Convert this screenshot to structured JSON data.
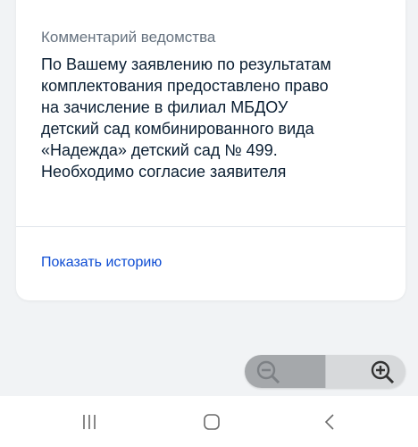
{
  "card": {
    "comment_label": "Комментарий ведомства",
    "comment_text": "По Вашему заявлению по результатам\nкомплектования предоставлено право\nна зачисление в филиал МБДОУ\nдетский сад комбинированного вида\n«Надежда» детский сад № 499.\nНеобходимо согласие заявителя",
    "show_history_link": "Показать историю"
  },
  "zoom": {
    "out_icon": "zoom-out-icon",
    "in_icon": "zoom-in-icon"
  },
  "navigation": {
    "recent_icon": "recent-apps-icon",
    "home_icon": "home-icon",
    "back_icon": "back-icon"
  },
  "colors": {
    "link": "#0d4cd3",
    "text": "#0b1f33",
    "muted": "#66727f",
    "background": "#f1f3f5"
  }
}
